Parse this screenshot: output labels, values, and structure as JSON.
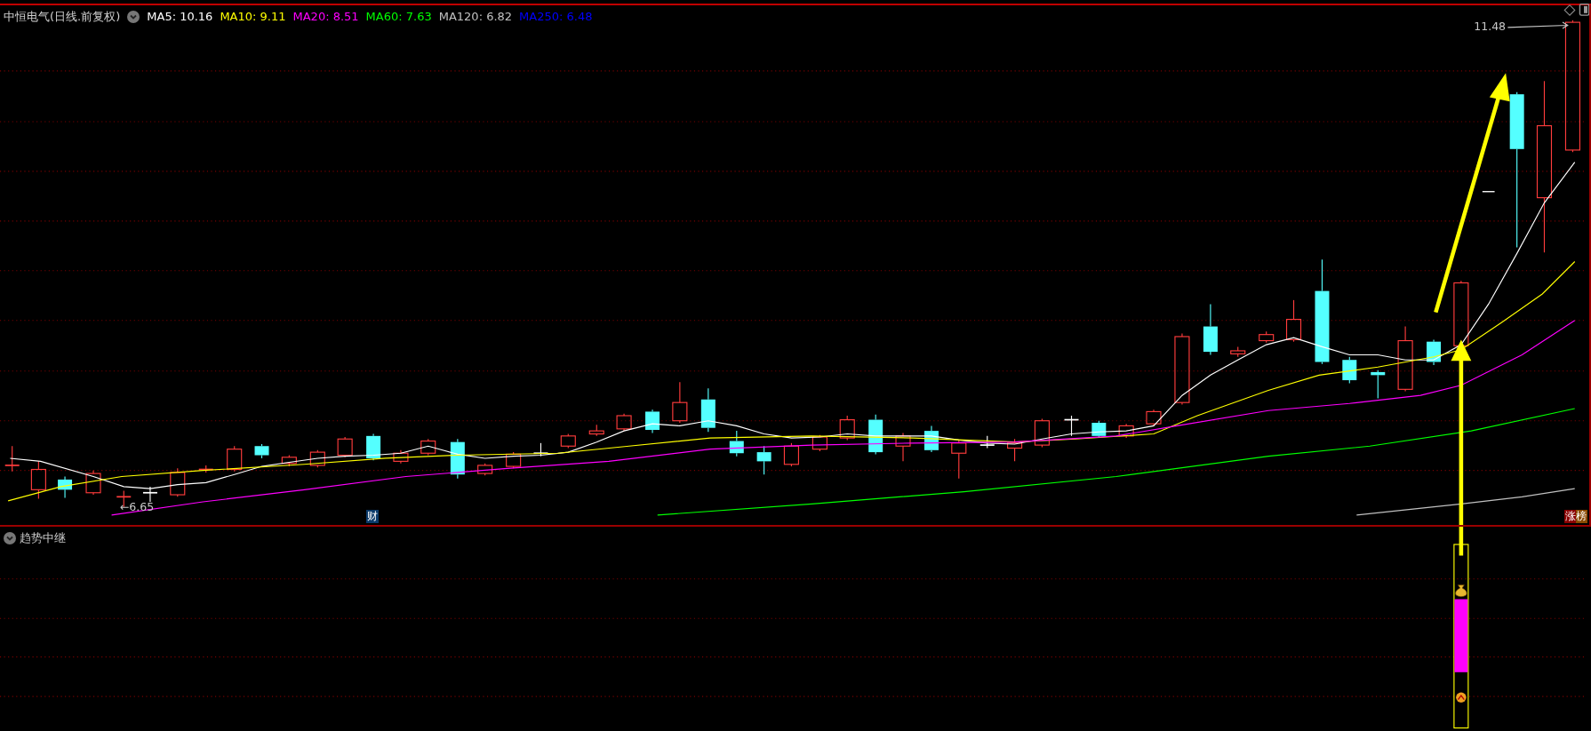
{
  "header": {
    "title": "中恒电气(日线.前复权)"
  },
  "legend": [
    {
      "label": "MA5: 10.16",
      "color": "#ffffff"
    },
    {
      "label": "MA10: 9.11",
      "color": "#ffff00"
    },
    {
      "label": "MA20: 8.51",
      "color": "#ff00ff"
    },
    {
      "label": "MA60: 7.63",
      "color": "#00ff00"
    },
    {
      "label": "MA120: 6.82",
      "color": "#c0c0c0"
    },
    {
      "label": "MA250: 6.48",
      "color": "#0000ff"
    }
  ],
  "main_chart": {
    "high_label": "11.48",
    "low_label": "←6.65",
    "markers": [
      {
        "text": "财",
        "kind": "finance"
      },
      {
        "text": "涨榜",
        "kind": "limit_up"
      }
    ]
  },
  "indicator_pane": {
    "title": "趋势中继"
  }
}
